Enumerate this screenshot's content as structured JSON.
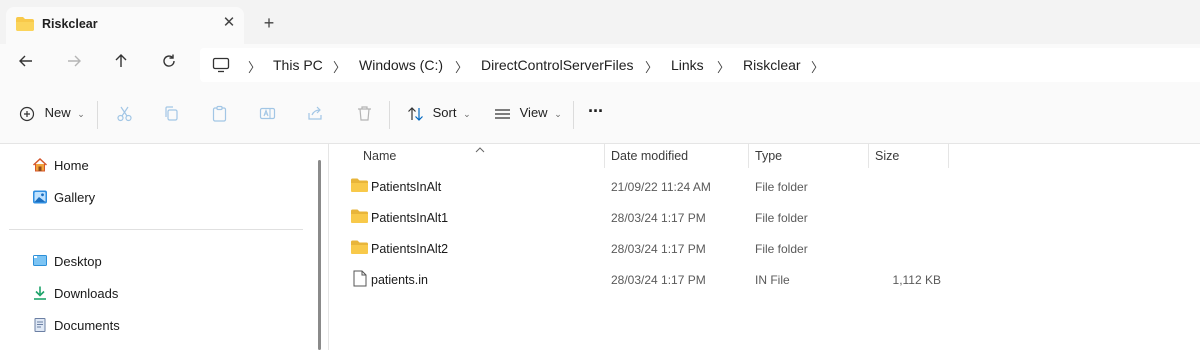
{
  "tab": {
    "title": "Riskclear",
    "close": "✕",
    "new": "+"
  },
  "breadcrumb": [
    "This PC",
    "Windows (C:)",
    "DirectControlServerFiles",
    "Links",
    "Riskclear"
  ],
  "toolbar": {
    "new_label": "New",
    "sort_label": "Sort",
    "view_label": "View",
    "more": "···"
  },
  "sidebar": {
    "top": [
      {
        "label": "Home",
        "icon": "home-icon"
      },
      {
        "label": "Gallery",
        "icon": "gallery-icon"
      }
    ],
    "quick": [
      {
        "label": "Desktop",
        "icon": "desktop-icon"
      },
      {
        "label": "Downloads",
        "icon": "downloads-icon"
      },
      {
        "label": "Documents",
        "icon": "documents-icon"
      }
    ]
  },
  "columns": {
    "name": "Name",
    "date": "Date modified",
    "type": "Type",
    "size": "Size"
  },
  "files": [
    {
      "name": "PatientsInAlt",
      "date": "21/09/22 11:24 AM",
      "type": "File folder",
      "size": "",
      "icon": "folder-icon"
    },
    {
      "name": "PatientsInAlt1",
      "date": "28/03/24 1:17 PM",
      "type": "File folder",
      "size": "",
      "icon": "folder-icon"
    },
    {
      "name": "PatientsInAlt2",
      "date": "28/03/24 1:17 PM",
      "type": "File folder",
      "size": "",
      "icon": "folder-icon"
    },
    {
      "name": "patients.in",
      "date": "28/03/24 1:17 PM",
      "type": "IN File",
      "size": "1,112 KB",
      "icon": "file-icon"
    }
  ],
  "colors": {
    "folder": "#f8c94a",
    "accent": "#0067c0"
  }
}
